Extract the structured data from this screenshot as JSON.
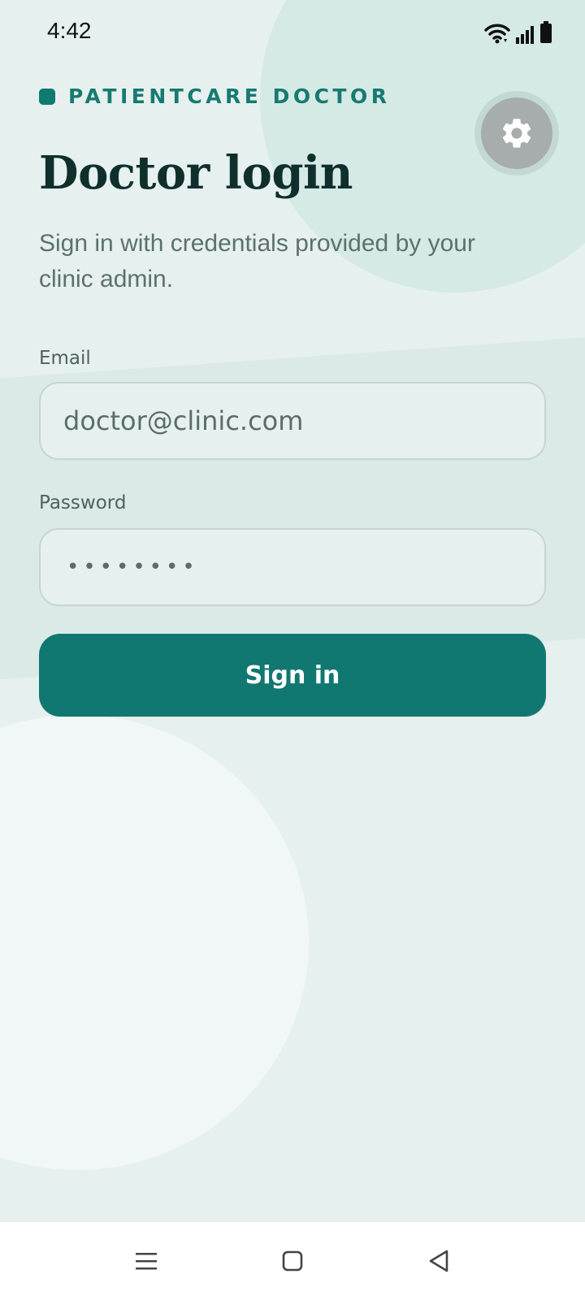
{
  "status_bar": {
    "time": "4:42",
    "icons": [
      "wifi-icon",
      "signal-icon",
      "battery-icon"
    ]
  },
  "brand": {
    "name": "PATIENTCARE DOCTOR",
    "accent_color": "#117a70"
  },
  "settings": {
    "icon": "gear-icon"
  },
  "login": {
    "title": "Doctor login",
    "subtitle": "Sign in with credentials provided by your clinic admin.",
    "email_label": "Email",
    "email_placeholder": "doctor@clinic.com",
    "password_label": "Password",
    "password_mask": "••••••••",
    "submit_label": "Sign in"
  },
  "nav_bar": {
    "icons": [
      "menu-icon",
      "home-icon",
      "back-icon"
    ]
  },
  "colors": {
    "background": "#e6f0ee",
    "primary_button": "#107870",
    "title_text": "#0f2f2c"
  }
}
